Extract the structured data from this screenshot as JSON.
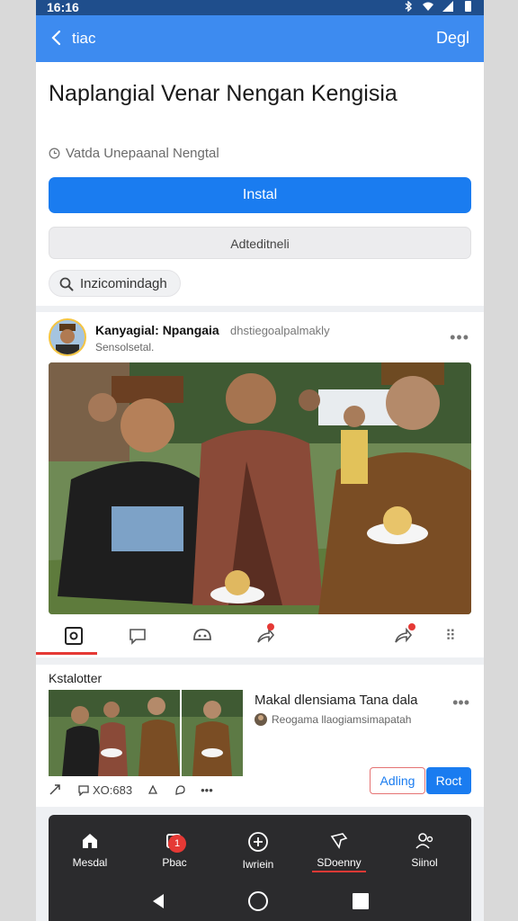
{
  "status_bar": {
    "time": "16:16"
  },
  "app_bar": {
    "back_label": "tiac",
    "action_label": "Degl"
  },
  "header": {
    "title": "Naplangial Venar Nengan Kengisia",
    "meta": "Vatda Unepaanal Nengtal",
    "primary_button": "Instal",
    "secondary_button": "Adteditneli",
    "chip": "Inzicomindagh"
  },
  "post": {
    "user": "Kanyagial: Npangaia",
    "handle": "dhstiegoalpalmakly",
    "subtitle": "Sensolsetal."
  },
  "related": {
    "section_label": "Kstalotter",
    "title": "Makal dlensiama Tana dala",
    "author": "Reogama llaogiamsimapatah",
    "outline_button": "Adling",
    "fill_button": "Roct",
    "comment_count": "XO:683"
  },
  "bottom_nav": {
    "items": [
      {
        "label": "Mesdal",
        "icon": "home-icon"
      },
      {
        "label": "Pbac",
        "icon": "inbox-icon",
        "badge": "1"
      },
      {
        "label": "Iwriein",
        "icon": "add-circle-icon"
      },
      {
        "label": "SDoenny",
        "icon": "pin-icon"
      },
      {
        "label": "Siinol",
        "icon": "profile-icon"
      }
    ]
  },
  "colors": {
    "accent": "#1a7cf0",
    "app_bar": "#3d8bf0",
    "badge": "#e53935"
  }
}
